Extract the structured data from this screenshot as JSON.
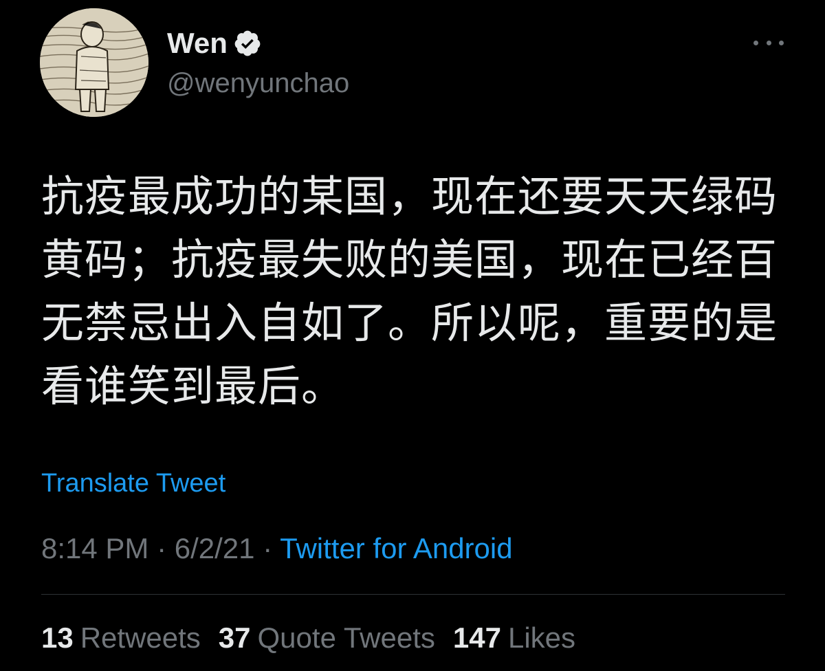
{
  "user": {
    "display_name": "Wen",
    "handle": "@wenyunchao",
    "verified": true
  },
  "tweet": {
    "text": "抗疫最成功的某国，现在还要天天绿码黄码；抗疫最失败的美国，现在已经百无禁忌出入自如了。所以呢，重要的是看谁笑到最后。",
    "translate_label": "Translate Tweet",
    "time": "8:14 PM",
    "date": "6/2/21",
    "separator": "·",
    "source": "Twitter for Android"
  },
  "stats": {
    "retweets_count": "13",
    "retweets_label": "Retweets",
    "quotes_count": "37",
    "quotes_label": "Quote Tweets",
    "likes_count": "147",
    "likes_label": "Likes"
  },
  "icons": {
    "verified": "verified-badge-icon",
    "more": "more-horizontal-icon"
  },
  "colors": {
    "background": "#000000",
    "text": "#e7e9ea",
    "secondary": "#71767b",
    "link": "#1d9bf0",
    "divider": "#2f3336"
  }
}
